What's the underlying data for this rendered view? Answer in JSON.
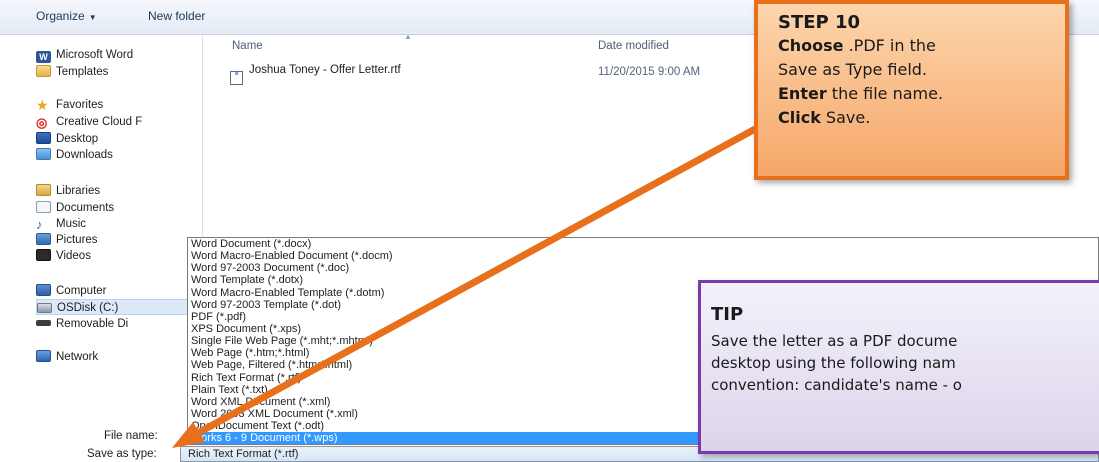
{
  "toolbar": {
    "organize": "Organize",
    "new_folder": "New folder"
  },
  "nav": {
    "microsoft_word": "Microsoft Word",
    "templates": "Templates",
    "favorites": "Favorites",
    "creative_cloud": "Creative Cloud F",
    "desktop": "Desktop",
    "downloads": "Downloads",
    "libraries": "Libraries",
    "documents": "Documents",
    "music": "Music",
    "pictures": "Pictures",
    "videos": "Videos",
    "computer": "Computer",
    "osdisk": "OSDisk (C:)",
    "removable": "Removable Di",
    "network": "Network"
  },
  "columns": {
    "name": "Name",
    "date_modified": "Date modified"
  },
  "file": {
    "name": "Joshua Toney - Offer Letter.rtf",
    "date": "11/20/2015 9:00 AM"
  },
  "dropdown": {
    "options": [
      "Word Document (*.docx)",
      "Word Macro-Enabled Document (*.docm)",
      "Word 97-2003 Document (*.doc)",
      "Word Template (*.dotx)",
      "Word Macro-Enabled Template (*.dotm)",
      "Word 97-2003 Template (*.dot)",
      "PDF (*.pdf)",
      "XPS Document (*.xps)",
      "Single File Web Page (*.mht;*.mhtml)",
      "Web Page (*.htm;*.html)",
      "Web Page, Filtered (*.htm;*.html)",
      "Rich Text Format (*.rtf)",
      "Plain Text (*.txt)",
      "Word XML Document (*.xml)",
      "Word 2003 XML Document (*.xml)",
      "OpenDocument Text (*.odt)",
      "Works 6 - 9 Document (*.wps)"
    ],
    "selected_index": 16
  },
  "fields": {
    "file_name_label": "File name:",
    "save_as_type_label": "Save as type:",
    "save_as_type_value": "Rich Text Format (*.rtf)"
  },
  "step": {
    "title": "STEP 10",
    "l1_bold": "Choose",
    "l1_rest": " .PDF in the",
    "l2": "Save as Type field.",
    "l3_bold": "Enter",
    "l3_rest": " the file name.",
    "l4_bold": "Click",
    "l4_rest": " Save."
  },
  "tip": {
    "title": "TIP",
    "l1": "Save the letter as a PDF docume",
    "l2": "desktop using the following nam",
    "l3": "convention: candidate's name - o"
  },
  "colors": {
    "arrow": "#e8701d",
    "selection": "#3399ff",
    "tip_border": "#7b3aa9"
  }
}
